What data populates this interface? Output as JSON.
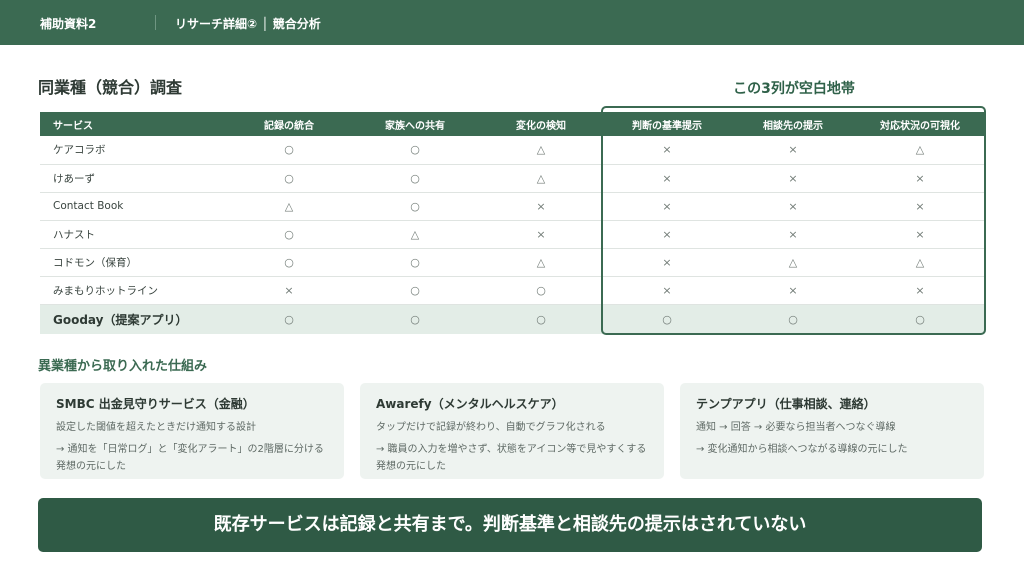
{
  "topbar": {
    "doc_label": "補助資料2",
    "breadcrumb": "リサーチ詳細② │ 競合分析"
  },
  "section_title": "同業種（競合）調査",
  "gap_label": "この3列が空白地帯",
  "table": {
    "columns": [
      "サービス",
      "記録の統合",
      "家族への共有",
      "変化の検知",
      "判断の基準提示",
      "相談先の提示",
      "対応状況の可視化"
    ],
    "rows": [
      {
        "name": "ケアコラボ",
        "cells": [
          "○",
          "○",
          "△",
          "×",
          "×",
          "△"
        ]
      },
      {
        "name": "けあーず",
        "cells": [
          "○",
          "○",
          "△",
          "×",
          "×",
          "×"
        ]
      },
      {
        "name": "Contact Book",
        "cells": [
          "△",
          "○",
          "×",
          "×",
          "×",
          "×"
        ]
      },
      {
        "name": "ハナスト",
        "cells": [
          "○",
          "△",
          "×",
          "×",
          "×",
          "×"
        ]
      },
      {
        "name": "コドモン（保育）",
        "cells": [
          "○",
          "○",
          "△",
          "×",
          "△",
          "△"
        ]
      },
      {
        "name": "みまもりホットライン",
        "cells": [
          "×",
          "○",
          "○",
          "×",
          "×",
          "×"
        ]
      },
      {
        "name": "Gooday（提案アプリ）",
        "cells": [
          "○",
          "○",
          "○",
          "○",
          "○",
          "○"
        ]
      }
    ]
  },
  "other_industry": {
    "title": "異業種から取り入れた仕組み",
    "cards": [
      {
        "title": "SMBC 出金見守りサービス（金融）",
        "desc": "設定した閾値を超えたときだけ通知する設計",
        "note": "→ 通知を「日常ログ」と「変化アラート」の2階層に分ける発想の元にした"
      },
      {
        "title": "Awarefy（メンタルヘルスケア）",
        "desc": "タップだけで記録が終わり、自動でグラフ化される",
        "note": "→ 職員の入力を増やさず、状態をアイコン等で見やすくする発想の元にした"
      },
      {
        "title": "テンプアプリ（仕事相談、連絡）",
        "desc": "通知 → 回答 → 必要なら担当者へつなぐ導線",
        "note": "→ 変化通知から相談へつながる導線の元にした"
      }
    ]
  },
  "conclusion": "既存サービスは記録と共有まで。判断基準と相談先の提示はされていない",
  "colors": {
    "primary": "#3b6a52",
    "banner": "#2f5a45",
    "highlight_row": "#e3ede7",
    "card_bg": "#eef3f0"
  }
}
